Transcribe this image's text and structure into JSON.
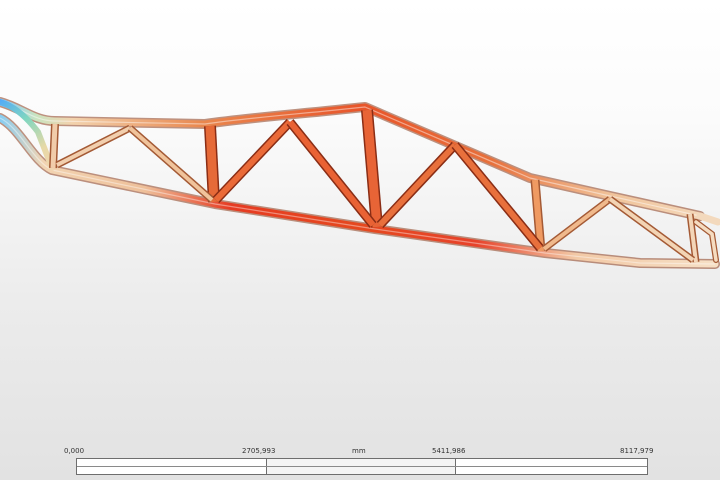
{
  "scale_bar": {
    "ticks": [
      "0,000",
      "2705,993",
      "5411,986",
      "8117,979"
    ],
    "unit": "mm"
  },
  "colors": {
    "background": "#e6e6e6",
    "truss_hot": "#e8341c",
    "truss_mid": "#e8763a",
    "truss_cool": "#f0c9a0",
    "truss_cold": "#6fb2ff"
  }
}
